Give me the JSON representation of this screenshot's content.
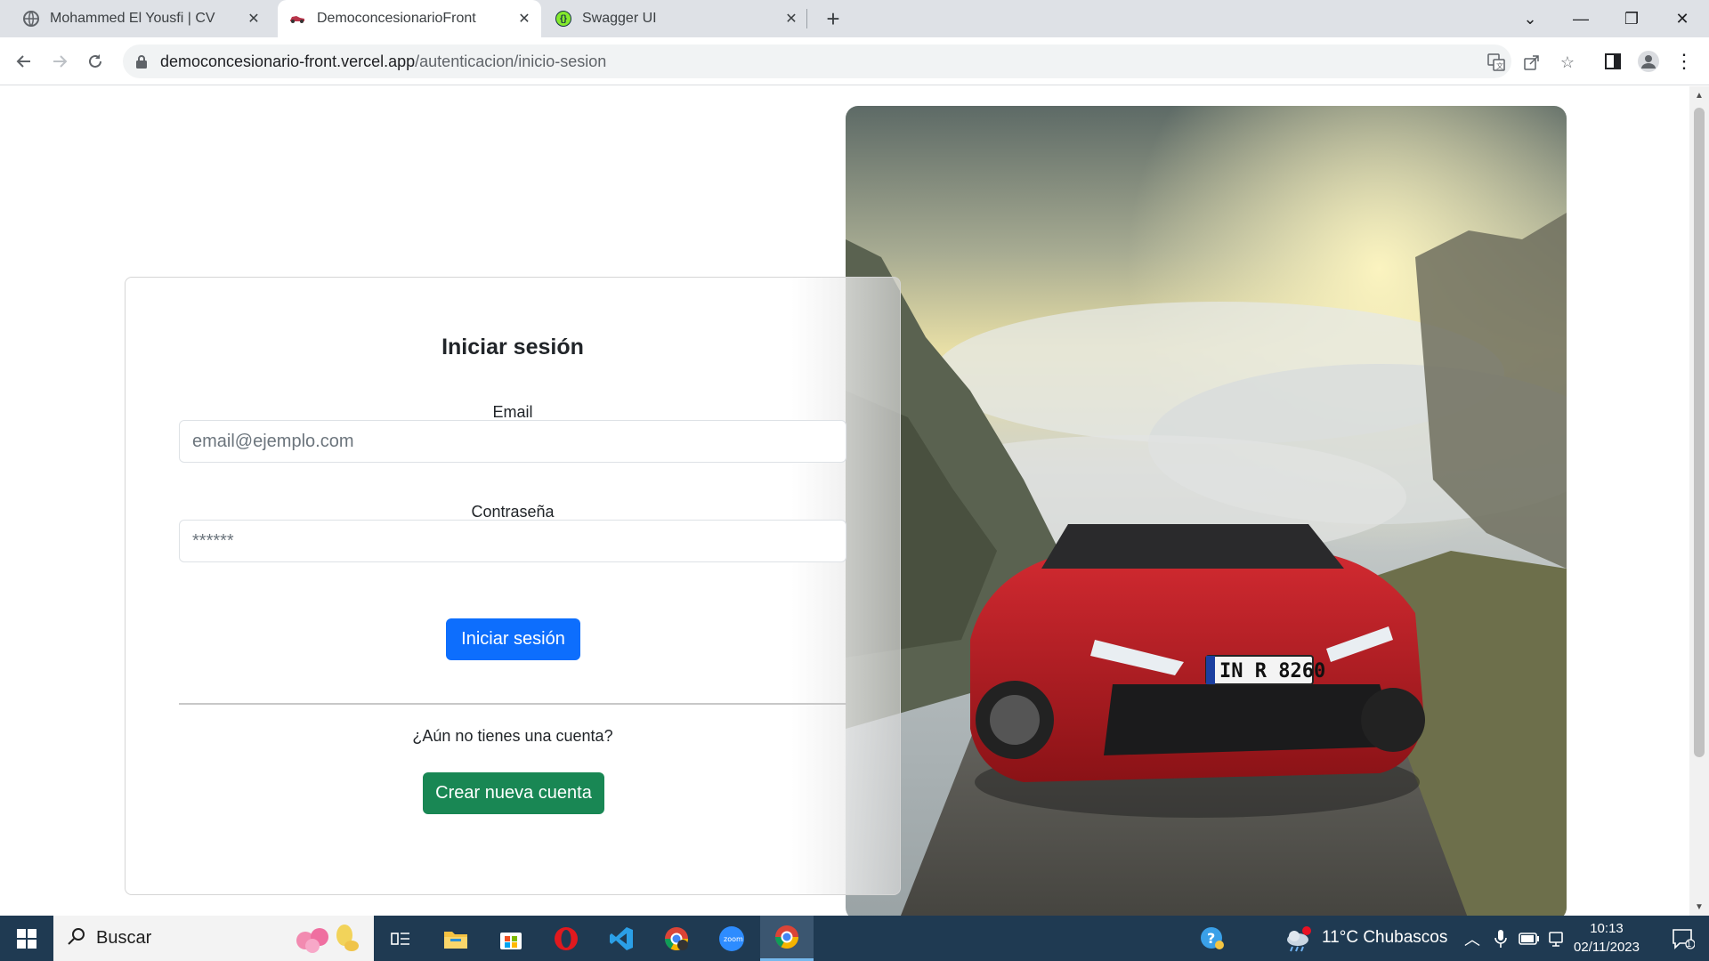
{
  "browser": {
    "tabs": [
      {
        "title": "Mohammed El Yousfi | CV",
        "active": false
      },
      {
        "title": "DemoconcesionarioFront",
        "active": true
      },
      {
        "title": "Swagger UI",
        "active": false
      }
    ],
    "url": {
      "domain": "democoncesionario-front.vercel.app",
      "path": "/autenticacion/inicio-sesion"
    }
  },
  "login": {
    "title": "Iniciar sesión",
    "email_label": "Email",
    "email_placeholder": "email@ejemplo.com",
    "password_label": "Contraseña",
    "password_placeholder": "******",
    "submit_label": "Iniciar sesión",
    "no_account_text": "¿Aún no tienes una cuenta?",
    "create_account_label": "Crear nueva cuenta"
  },
  "hero": {
    "plate_text": "IN R 8260"
  },
  "taskbar": {
    "search_placeholder": "Buscar",
    "weather": "11°C Chubascos",
    "time": "10:13",
    "date": "02/11/2023",
    "notification_count": "1"
  },
  "colors": {
    "primary": "#0d6efd",
    "success": "#198754",
    "taskbar": "#1f3a52"
  }
}
